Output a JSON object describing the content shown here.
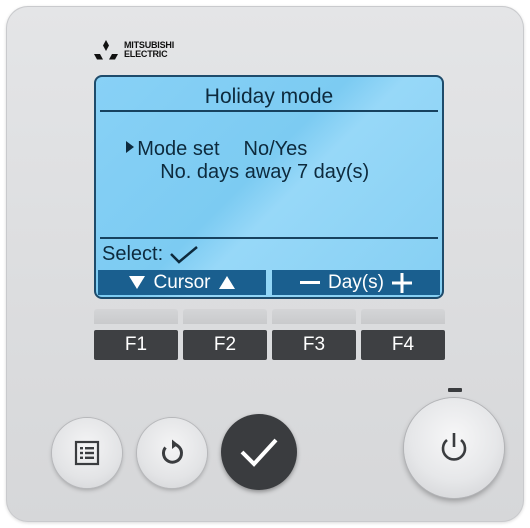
{
  "brand": {
    "name_line1": "MITSUBISHI",
    "name_line2": "ELECTRIC"
  },
  "screen": {
    "title": "Holiday mode",
    "rows": [
      {
        "label": "Mode set",
        "value": "No/Yes",
        "selected": true
      },
      {
        "label": "No. days away",
        "value": "7 day(s)",
        "selected": false
      }
    ],
    "select_label": "Select:",
    "function_bar": {
      "left_label": "Cursor",
      "right_label": "Day(s)"
    }
  },
  "function_keys": [
    "F1",
    "F2",
    "F3",
    "F4"
  ],
  "buttons": {
    "menu": "menu-icon",
    "return": "return-icon",
    "confirm": "check-icon",
    "power": "power-icon"
  },
  "colors": {
    "lcd_background": "#86cff4",
    "lcd_text": "#0d2a3d",
    "function_bar": "#1a5f8f",
    "key_dark": "#3e4043"
  }
}
